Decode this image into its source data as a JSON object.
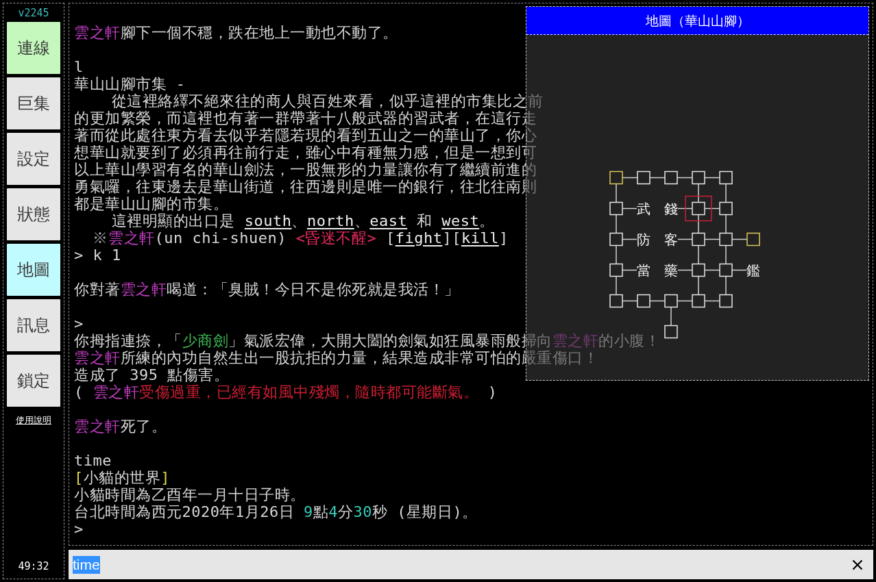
{
  "sidebar": {
    "version": "v2245",
    "buttons": [
      {
        "label": "連線",
        "on": true,
        "color": "#c4f8bc"
      },
      {
        "label": "巨集",
        "on": false
      },
      {
        "label": "設定",
        "on": false
      },
      {
        "label": "狀態",
        "on": false
      },
      {
        "label": "地圖",
        "on": true,
        "color": "#c0fbff"
      },
      {
        "label": "訊息",
        "on": false
      },
      {
        "label": "鎖定",
        "on": false
      }
    ],
    "help_link": "使用說明",
    "timer": "49:32"
  },
  "log": {
    "blocks": [
      [
        {
          "kind": "line",
          "segments": [
            {
              "kind": "name",
              "text": "雲之軒"
            },
            {
              "kind": "text",
              "text": "腳下一個不穩，跌在地上一動也不動了。"
            }
          ]
        }
      ],
      [
        {
          "kind": "line",
          "segments": [
            {
              "kind": "text",
              "text": "l"
            }
          ]
        },
        {
          "kind": "line",
          "segments": [
            {
              "kind": "text",
              "text": "華山山腳市集 -"
            }
          ]
        },
        {
          "kind": "paragraph",
          "text": "    從這裡絡繹不絕來往的商人與百姓來看，似乎這裡的市集比之前的更加繁榮，而這裡也有著一群帶著十八般武器的習武者，在這行走著而從此處往東方看去似乎若隱若現的看到五山之一的華山了，你心想華山就要到了必須再往前行走，雖心中有種無力感，但是一想到可以上華山學習有名的華山劍法，一股無形的力量讓你有了繼續前進的勇氣囉，往東邊去是華山街道，往西邊則是唯一的銀行，往北往南則都是華山山腳的市集。"
        },
        {
          "kind": "line",
          "segments": [
            {
              "kind": "text",
              "text": "    這裡明顯的出口是 "
            },
            {
              "kind": "link",
              "text": "south"
            },
            {
              "kind": "text",
              "text": "、"
            },
            {
              "kind": "link",
              "text": "north"
            },
            {
              "kind": "text",
              "text": "、"
            },
            {
              "kind": "link",
              "text": "east"
            },
            {
              "kind": "text",
              "text": " 和 "
            },
            {
              "kind": "link",
              "text": "west"
            },
            {
              "kind": "text",
              "text": "。"
            }
          ]
        },
        {
          "kind": "line",
          "segments": [
            {
              "kind": "symbol",
              "text": "  ※"
            },
            {
              "kind": "name",
              "text": "雲之軒"
            },
            {
              "kind": "text",
              "text": "(un chi-shuen) "
            },
            {
              "kind": "status",
              "text": "<昏迷不醒>"
            },
            {
              "kind": "text",
              "text": " ["
            },
            {
              "kind": "link",
              "text": "fight"
            },
            {
              "kind": "text",
              "text": "]["
            },
            {
              "kind": "link",
              "text": "kill"
            },
            {
              "kind": "text",
              "text": "]"
            }
          ]
        },
        {
          "kind": "line",
          "segments": [
            {
              "kind": "text",
              "text": "> k 1"
            }
          ]
        }
      ],
      [
        {
          "kind": "line",
          "segments": [
            {
              "kind": "text",
              "text": "你對著"
            },
            {
              "kind": "name",
              "text": "雲之軒"
            },
            {
              "kind": "text",
              "text": "喝道：「臭賊！今日不是你死就是我活！」"
            }
          ]
        }
      ],
      [
        {
          "kind": "line",
          "segments": [
            {
              "kind": "text",
              "text": ">"
            }
          ]
        },
        {
          "kind": "line",
          "segments": [
            {
              "kind": "text",
              "text": "你拇指連捺，「"
            },
            {
              "kind": "skill",
              "text": "少商劍"
            },
            {
              "kind": "text",
              "text": "」氣派宏偉，大開大闔的劍氣如狂風暴雨般掃向"
            },
            {
              "kind": "name",
              "text": "雲之軒"
            },
            {
              "kind": "text",
              "text": "的小腹！"
            }
          ]
        },
        {
          "kind": "line",
          "segments": [
            {
              "kind": "name",
              "text": "雲之軒"
            },
            {
              "kind": "text",
              "text": "所練的內功自然生出一股抗拒的力量，結果造成非常可怕的嚴重傷口！"
            }
          ]
        },
        {
          "kind": "line",
          "segments": [
            {
              "kind": "text",
              "text": "造成了 395 點傷害。"
            }
          ]
        },
        {
          "kind": "line",
          "segments": [
            {
              "kind": "text",
              "text": "( "
            },
            {
              "kind": "name",
              "text": "雲之軒"
            },
            {
              "kind": "danger",
              "text": "受傷過重，已經有如風中殘燭，隨時都可能斷氣。"
            },
            {
              "kind": "text",
              "text": " )"
            }
          ]
        }
      ],
      [
        {
          "kind": "line",
          "segments": [
            {
              "kind": "name",
              "text": "雲之軒"
            },
            {
              "kind": "text",
              "text": "死了。"
            }
          ]
        }
      ],
      [
        {
          "kind": "line",
          "segments": [
            {
              "kind": "text",
              "text": "time"
            }
          ]
        },
        {
          "kind": "line",
          "segments": [
            {
              "kind": "bracket",
              "text": "["
            },
            {
              "kind": "text",
              "text": "小貓的世界"
            },
            {
              "kind": "bracket",
              "text": "]"
            }
          ]
        },
        {
          "kind": "line",
          "segments": [
            {
              "kind": "text",
              "text": "小貓時間為乙酉年一月十日子時。"
            }
          ]
        },
        {
          "kind": "line",
          "segments": [
            {
              "kind": "text",
              "text": "台北時間為西元2020年1月26日 "
            },
            {
              "kind": "number",
              "text": "9"
            },
            {
              "kind": "text",
              "text": "點"
            },
            {
              "kind": "number",
              "text": "4"
            },
            {
              "kind": "text",
              "text": "分"
            },
            {
              "kind": "number",
              "text": "30"
            },
            {
              "kind": "text",
              "text": "秒 (星期日)。"
            }
          ]
        },
        {
          "kind": "line",
          "segments": [
            {
              "kind": "text",
              "text": ">"
            }
          ]
        }
      ]
    ]
  },
  "map": {
    "title": "地圖（華山山腳）",
    "rows": [
      [
        {
          "kind": "room",
          "color": "#dcc85a",
          "current": false,
          "east": true,
          "south": true
        },
        {
          "kind": "room",
          "color": "#e6e6e6",
          "current": false,
          "east": true,
          "south": false
        },
        {
          "kind": "room",
          "color": "#e6e6e6",
          "current": false,
          "east": true,
          "south": false
        },
        {
          "kind": "room",
          "color": "#e6e6e6",
          "current": false,
          "east": true,
          "south": true
        },
        {
          "kind": "room",
          "color": "#e6e6e6",
          "current": false,
          "east": false,
          "south": true
        }
      ],
      [
        {
          "kind": "room",
          "color": "#e6e6e6",
          "current": false,
          "east": true,
          "south": true
        },
        {
          "kind": "label",
          "text": "武",
          "east": false
        },
        {
          "kind": "label",
          "text": "錢",
          "east": true
        },
        {
          "kind": "room",
          "color": "#e6e6e6",
          "current": true,
          "east": true,
          "south": true
        },
        {
          "kind": "room",
          "color": "#e6e6e6",
          "current": false,
          "east": false,
          "south": true
        }
      ],
      [
        {
          "kind": "room",
          "color": "#e6e6e6",
          "current": false,
          "east": true,
          "south": true
        },
        {
          "kind": "label",
          "text": "防",
          "east": false
        },
        {
          "kind": "label",
          "text": "客",
          "east": true
        },
        {
          "kind": "room",
          "color": "#e6e6e6",
          "current": false,
          "east": true,
          "south": true
        },
        {
          "kind": "room",
          "color": "#e6e6e6",
          "current": false,
          "east": true,
          "south": true
        },
        {
          "kind": "room",
          "color": "#dcc85a",
          "current": false,
          "east": false,
          "south": false
        }
      ],
      [
        {
          "kind": "room",
          "color": "#e6e6e6",
          "current": false,
          "east": true,
          "south": true
        },
        {
          "kind": "label",
          "text": "當",
          "east": false
        },
        {
          "kind": "label",
          "text": "藥",
          "east": true
        },
        {
          "kind": "room",
          "color": "#e6e6e6",
          "current": false,
          "east": true,
          "south": true
        },
        {
          "kind": "room",
          "color": "#e6e6e6",
          "current": false,
          "east": true,
          "south": true
        },
        {
          "kind": "label",
          "text": "鑑",
          "east": false
        }
      ],
      [
        {
          "kind": "room",
          "color": "#e6e6e6",
          "current": false,
          "east": true,
          "south": false
        },
        {
          "kind": "room",
          "color": "#e6e6e6",
          "current": false,
          "east": true,
          "south": false
        },
        {
          "kind": "room",
          "color": "#e6e6e6",
          "current": false,
          "east": true,
          "south": true
        },
        {
          "kind": "room",
          "color": "#e6e6e6",
          "current": false,
          "east": true,
          "south": false
        },
        {
          "kind": "room",
          "color": "#e6e6e6",
          "current": false,
          "east": false,
          "south": false
        }
      ],
      [
        {
          "kind": "empty"
        },
        {
          "kind": "empty"
        },
        {
          "kind": "room",
          "color": "#e6e6e6",
          "current": false,
          "east": false,
          "south": false
        }
      ]
    ]
  },
  "input": {
    "value": "time",
    "selected": true
  }
}
